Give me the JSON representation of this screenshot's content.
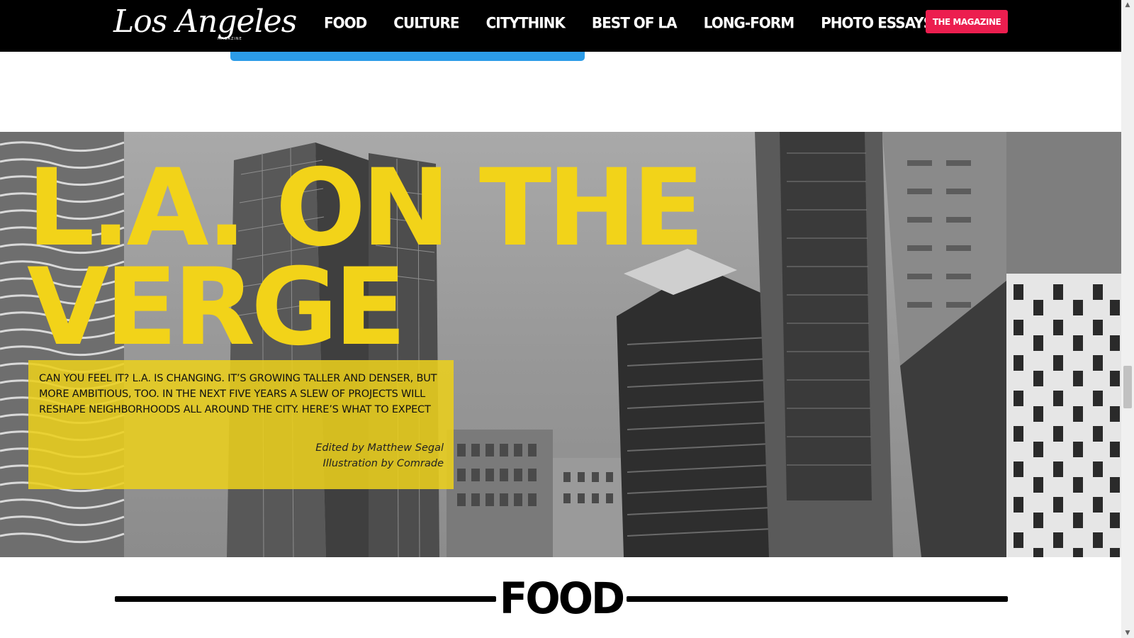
{
  "header": {
    "logo_text": "Los Angeles",
    "logo_subtext": "MAGAZINE",
    "nav": [
      "FOOD",
      "CULTURE",
      "CITYTHINK",
      "BEST OF LA",
      "LONG-FORM",
      "PHOTO ESSAYS"
    ],
    "magazine_button": "THE MAGAZINE"
  },
  "hero": {
    "title_line1": "L.A. ON THE",
    "title_line2": "VERGE",
    "dek": "Can you feel it? L.A. is changing. It’s growing taller and denser, but more ambitious, too. In the next five years a slew of projects will reshape neighborhoods all around the city. Here’s what to expect",
    "credit_editor": "Edited by Matthew Segal",
    "credit_illustration": "Illustration by Comrade"
  },
  "section": {
    "title": "FOOD"
  },
  "colors": {
    "header_bg": "#000000",
    "accent_red": "#ec1e4f",
    "accent_blue": "#2c9ce8",
    "title_yellow": "#f2d319",
    "dek_yellow": "#ebd01c"
  }
}
